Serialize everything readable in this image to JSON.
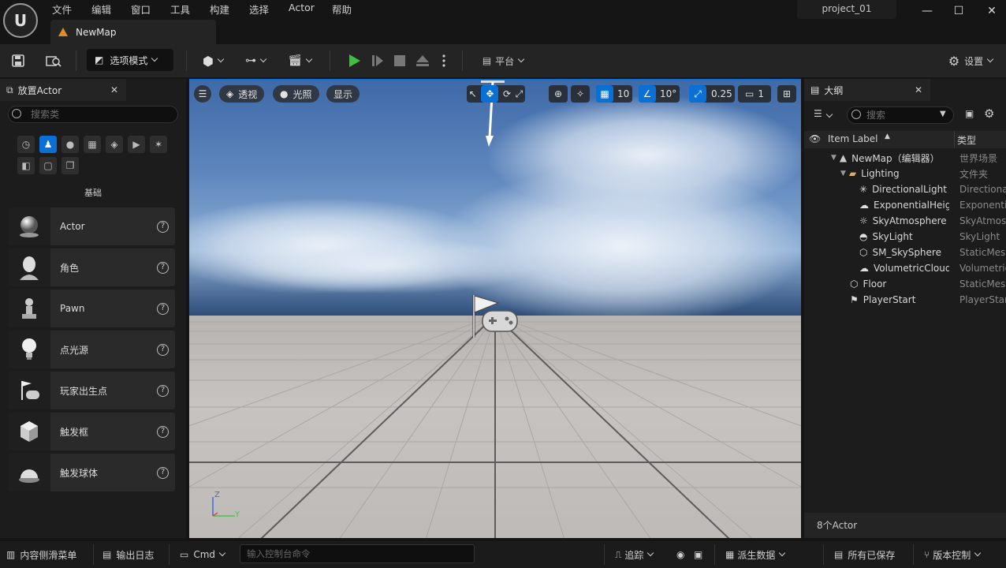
{
  "menu": [
    "文件",
    "编辑",
    "窗口",
    "工具",
    "构建",
    "选择",
    "Actor",
    "帮助"
  ],
  "project_name": "project_01",
  "tab_title": "NewMap",
  "toolbar": {
    "mode_label": "选项模式",
    "platform_label": "平台",
    "settings_label": "设置"
  },
  "left_panel": {
    "title": "放置Actor",
    "search_placeholder": "搜索类",
    "category_label": "基础",
    "items": [
      "Actor",
      "角色",
      "Pawn",
      "点光源",
      "玩家出生点",
      "触发框",
      "触发球体"
    ]
  },
  "viewport": {
    "perspective_label": "透视",
    "lighting_label": "光照",
    "show_label": "显示",
    "grid_snap": "10",
    "rotation_snap": "10°",
    "scale_snap": "0.25",
    "camera_speed": "1",
    "axis_z": "Z",
    "axis_y": "Y"
  },
  "outliner": {
    "title": "大纲",
    "search_placeholder": "搜索",
    "col_label": "Item Label",
    "col_type": "类型",
    "rows": [
      {
        "name": "NewMap（编辑器）",
        "type": "世界场景"
      },
      {
        "name": "Lighting",
        "type": "文件夹"
      },
      {
        "name": "DirectionalLight",
        "type": "DirectionalLight"
      },
      {
        "name": "ExponentialHeightFog",
        "type": "ExponentialHeightFog"
      },
      {
        "name": "SkyAtmosphere",
        "type": "SkyAtmosphere"
      },
      {
        "name": "SkyLight",
        "type": "SkyLight"
      },
      {
        "name": "SM_SkySphere",
        "type": "StaticMeshActor"
      },
      {
        "name": "VolumetricCloud",
        "type": "VolumetricCloud"
      },
      {
        "name": "Floor",
        "type": "StaticMeshActor"
      },
      {
        "name": "PlayerStart",
        "type": "PlayerStart"
      }
    ],
    "footer": "8个Actor"
  },
  "statusbar": {
    "content_drawer": "内容侧滑菜单",
    "output_log": "输出日志",
    "cmd_label": "Cmd",
    "cmd_placeholder": "输入控制台命令",
    "trace": "追踪",
    "derived_data": "派生数据",
    "all_saved": "所有已保存",
    "source_control": "版本控制"
  },
  "colors": {
    "accent": "#0a70d6",
    "play": "#3fbf3f",
    "tab_icon": "#e08a2a"
  }
}
